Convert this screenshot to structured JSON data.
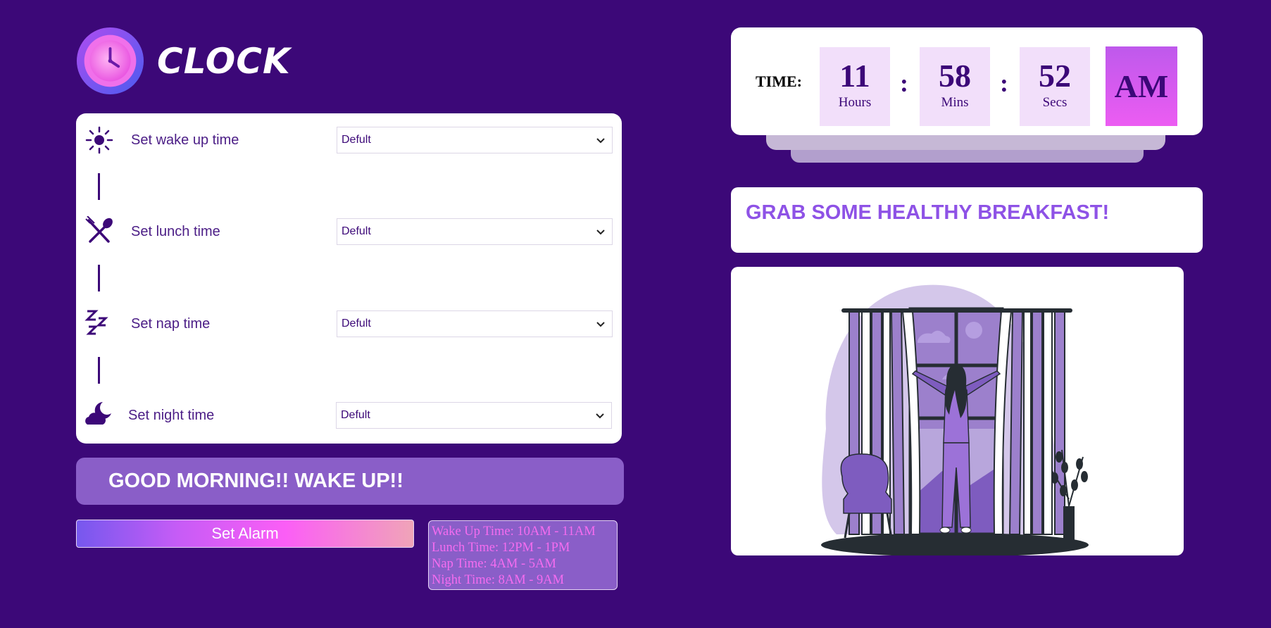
{
  "app": {
    "logo_text": "CLOCK"
  },
  "settings": [
    {
      "label": "Set wake up time",
      "selected": "Defult",
      "icon": "sun-icon"
    },
    {
      "label": "Set lunch time",
      "selected": "Defult",
      "icon": "fork-spoon-icon"
    },
    {
      "label": "Set nap time",
      "selected": "Defult",
      "icon": "zzz-icon"
    },
    {
      "label": "Set night time",
      "selected": "Defult",
      "icon": "cloud-moon-icon"
    }
  ],
  "greeting": "GOOD MORNING!! WAKE UP!!",
  "set_alarm_label": "Set Alarm",
  "schedule": [
    "Wake Up Time: 10AM - 11AM",
    "Lunch Time: 12PM - 1PM",
    "Nap Time: 4AM - 5AM",
    "Night Time: 8AM - 9AM"
  ],
  "clock": {
    "label": "TIME:",
    "hours": "11",
    "hours_unit": "Hours",
    "mins": "58",
    "mins_unit": "Mins",
    "secs": "52",
    "secs_unit": "Secs",
    "separator": ":",
    "ampm": "AM"
  },
  "message": "GRAB SOME HEALTHY BREAKFAST!",
  "colors": {
    "background": "#3c0878",
    "accent": "#8a5ec8",
    "highlight": "#f56cf0",
    "message": "#8e52e6"
  }
}
